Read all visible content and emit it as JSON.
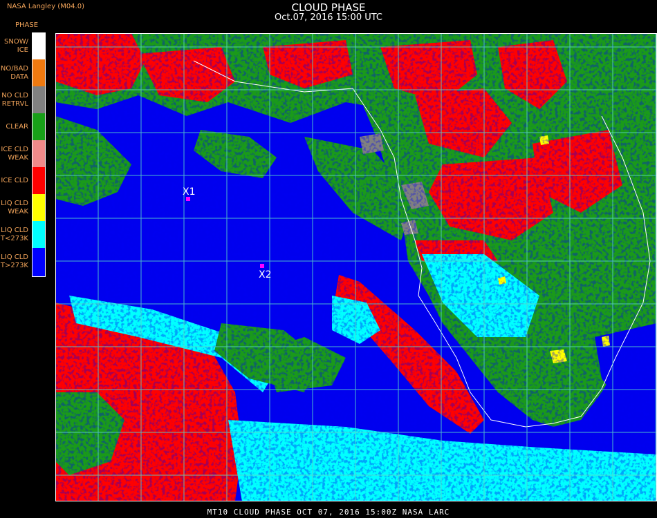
{
  "header": {
    "org": "NASA Langley (M04.0)",
    "title": "CLOUD PHASE",
    "subtitle": "Oct.07, 2016 15:00 UTC"
  },
  "legend": {
    "title": "PHASE",
    "items": [
      {
        "label": "SNOW/\nICE",
        "color": "#ffffff"
      },
      {
        "label": "NO/BAD\nDATA",
        "color": "#f07a10"
      },
      {
        "label": "NO CLD\nRETRVL",
        "color": "#808080"
      },
      {
        "label": "CLEAR",
        "color": "#18a018"
      },
      {
        "label": "ICE CLD\nWEAK",
        "color": "#f08a8a"
      },
      {
        "label": "ICE CLD",
        "color": "#ff0000"
      },
      {
        "label": "LIQ CLD\nWEAK",
        "color": "#ffff00"
      },
      {
        "label": "LIQ CLD\nT<273K",
        "color": "#00ffff"
      },
      {
        "label": "LIQ CLD\nT>273K",
        "color": "#0000ff"
      }
    ]
  },
  "markers": [
    {
      "label": "X1"
    },
    {
      "label": "X2"
    }
  ],
  "footer": "MT10  CLOUD PHASE   OCT 07, 2016 15:00Z   NASA LARC",
  "colors": {
    "ocean_liq": "#0000ee",
    "clear_land": "#1a9a1a",
    "ice": "#ff0000",
    "liq_cold": "#00ffff",
    "grid": "#5ad8c8",
    "marker": "#ff00ff"
  }
}
